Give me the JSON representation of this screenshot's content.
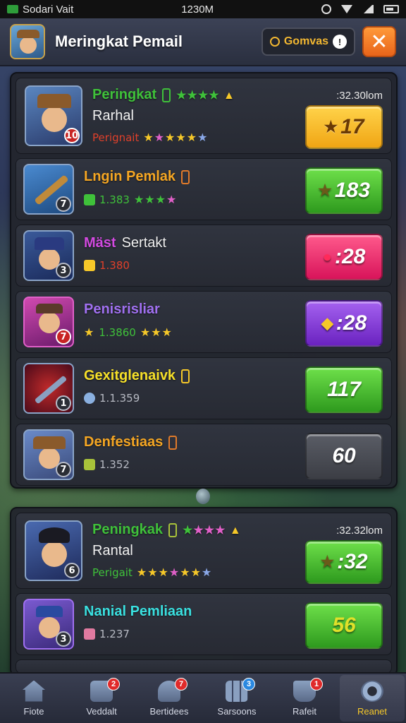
{
  "status_bar": {
    "left_text": "Sodari Vait",
    "time": "1230M"
  },
  "header": {
    "title": "Meringkat Pemail",
    "gems_label": "Gomvas",
    "info_symbol": "!",
    "close_symbol": "✕"
  },
  "panel1": {
    "featured": {
      "name": "Peringkat",
      "name_color": "#3fc13a",
      "second_line": "Rarhal",
      "sub_text": "Perignait",
      "sub_color": "#e0402a",
      "time": ":32.30lom",
      "level": "10",
      "score": "17",
      "score_icon": "★"
    },
    "rows": [
      {
        "name": "Lngin Pemlak",
        "name_color": "#f5a623",
        "level": "7",
        "sub_text": "1.383",
        "sub_color": "#3fc13a",
        "score": "183",
        "score_icon": "★",
        "button": "green"
      },
      {
        "name": "Mäst",
        "name2": "Sertakt",
        "name_color": "#d24ae0",
        "level": "3",
        "sub_text": "1.380",
        "sub_color": "#e0402a",
        "score": ":28",
        "score_icon": "●",
        "button": "pink"
      },
      {
        "name": "Penisrisliar",
        "name_color": "#a070f0",
        "level": "7",
        "sub_text": "1.3860",
        "sub_color": "#3fc13a",
        "score": ":28",
        "score_icon": "◆",
        "button": "purple"
      },
      {
        "name": "Gexitglenaivk",
        "name_color": "#f6e029",
        "level": "1",
        "sub_text": "1.1.359",
        "sub_color": "#b6b9c2",
        "score": "117",
        "score_icon": "",
        "button": "green"
      },
      {
        "name": "Denfestiaas",
        "name_color": "#f5a623",
        "level": "7",
        "sub_text": "1.352",
        "sub_color": "#b6b9c2",
        "score": "60",
        "score_icon": "",
        "button": "gray"
      }
    ]
  },
  "panel2": {
    "featured": {
      "name": "Peningkak",
      "name_color": "#3fc13a",
      "second_line": "Rantal",
      "sub_text": "Perigait",
      "sub_color": "#3fc13a",
      "time": ":32.32lom",
      "level": "6",
      "score": ":32",
      "score_icon": "★"
    },
    "rows": [
      {
        "name": "Nanial Pemliaan",
        "name_color": "#3ae0e0",
        "level": "3",
        "sub_text": "1.237",
        "sub_color": "#b6b9c2",
        "score": "56",
        "score_icon": "",
        "button": "green"
      }
    ]
  },
  "nav": [
    {
      "label": "Fiote",
      "icon": "home-icon",
      "badge": ""
    },
    {
      "label": "Veddalt",
      "icon": "mail-icon",
      "badge": "2"
    },
    {
      "label": "Bertidees",
      "icon": "hero-icon",
      "badge": "7"
    },
    {
      "label": "Sarsoons",
      "icon": "grid-icon",
      "badge": "3"
    },
    {
      "label": "Rafeit",
      "icon": "shop-icon",
      "badge": "1"
    },
    {
      "label": "Reanet",
      "icon": "disc-icon",
      "badge": ""
    }
  ]
}
